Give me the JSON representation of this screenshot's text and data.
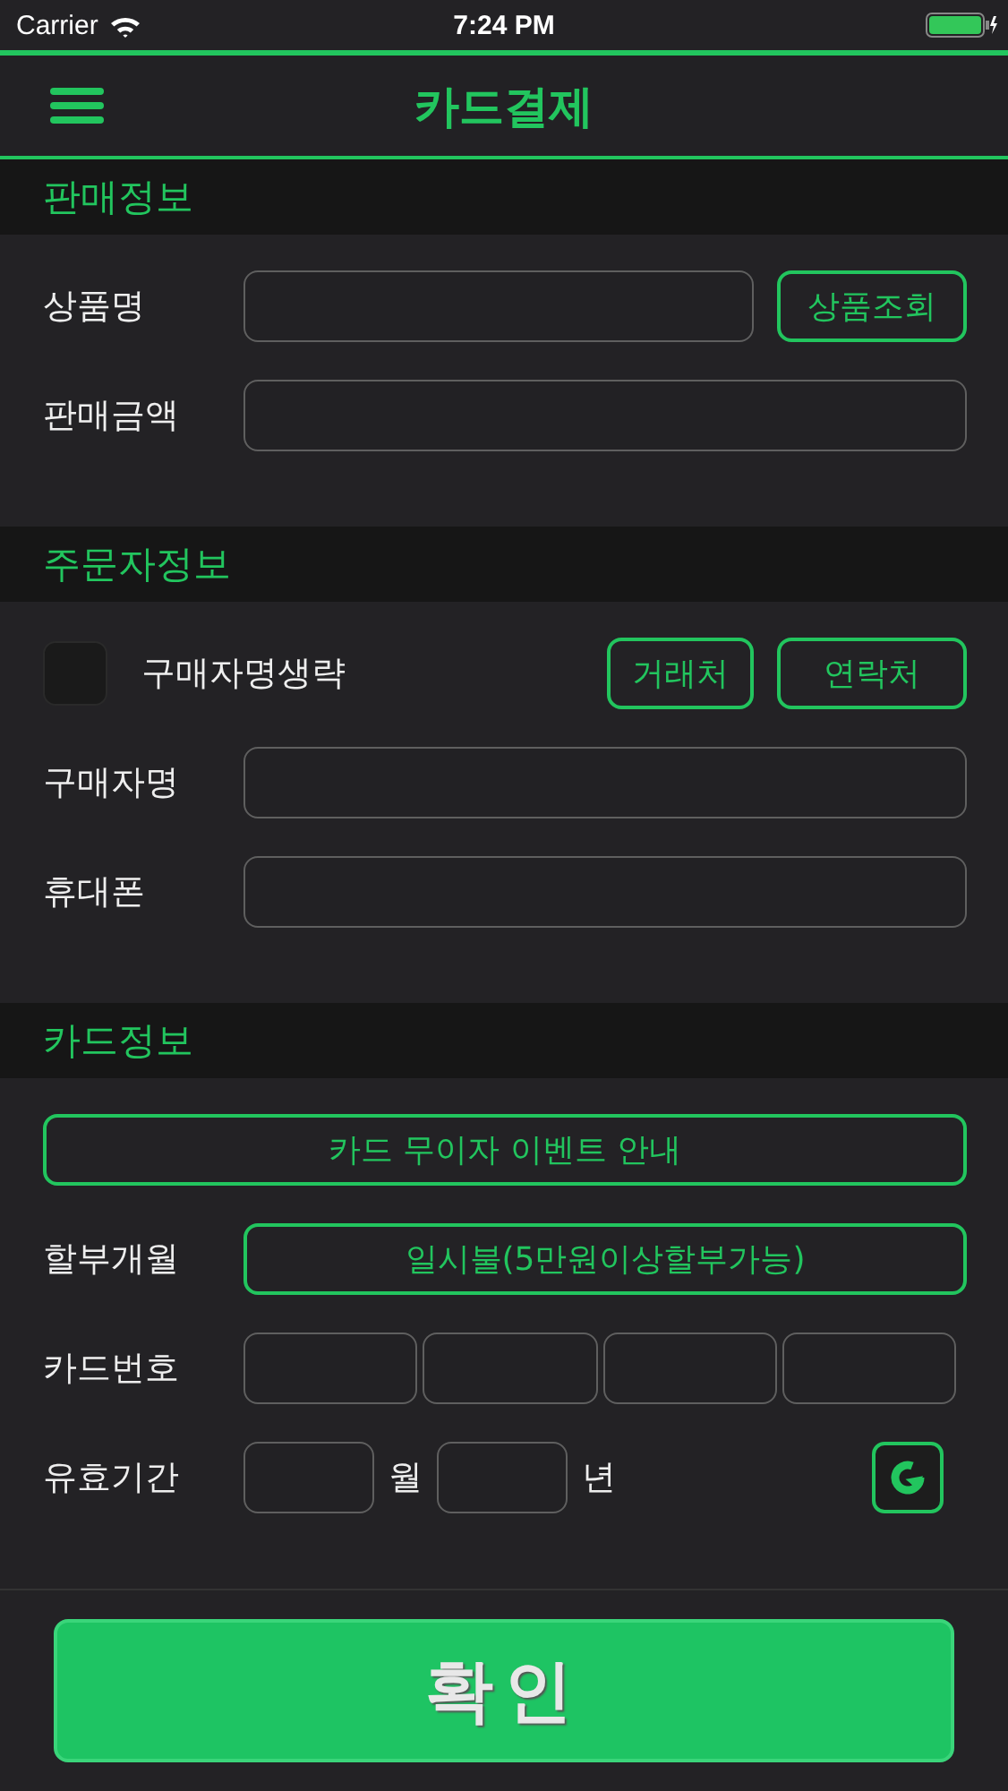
{
  "status_bar": {
    "carrier": "Carrier",
    "time": "7:24 PM"
  },
  "nav": {
    "title": "카드결제"
  },
  "sections": [
    {
      "title": "판매정보",
      "rows": [
        {
          "kind": "field",
          "label": "상품명",
          "button": "상품조회"
        },
        {
          "kind": "field",
          "label": "판매금액"
        }
      ]
    },
    {
      "title": "주문자정보",
      "rows": [
        {
          "kind": "checkbox",
          "label": "구매자명생략",
          "checked": false,
          "buttons": [
            "거래처",
            "연락처"
          ]
        },
        {
          "kind": "field",
          "label": "구매자명"
        },
        {
          "kind": "field",
          "label": "휴대폰"
        }
      ]
    },
    {
      "title": "카드정보",
      "rows": [
        {
          "kind": "wide_button",
          "text": "카드 무이자 이벤트 안내"
        },
        {
          "kind": "select",
          "label": "할부개월",
          "value": "일시불(5만원이상할부가능)"
        },
        {
          "kind": "card_number",
          "label": "카드번호"
        },
        {
          "kind": "expiry",
          "label": "유효기간",
          "month_unit": "월",
          "year_unit": "년"
        }
      ]
    }
  ],
  "confirm_button": "확인"
}
